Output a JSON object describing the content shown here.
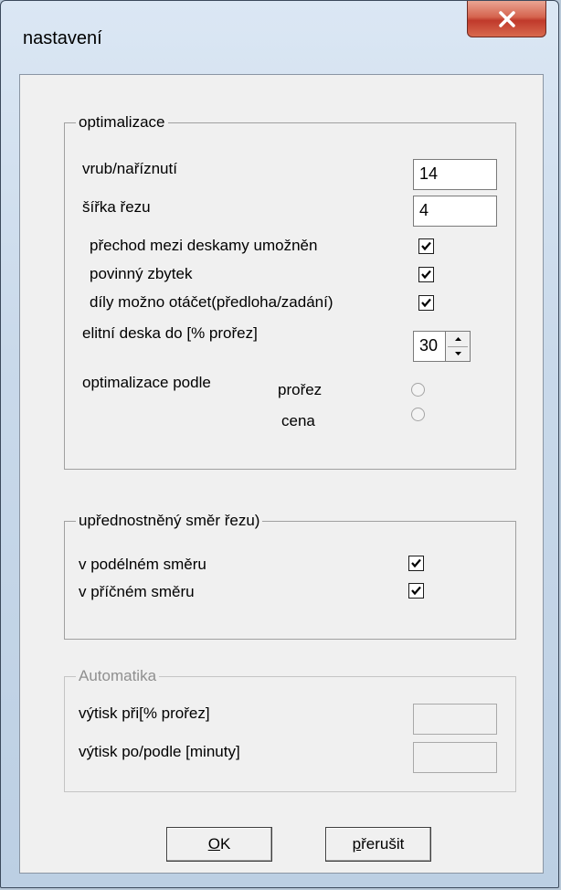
{
  "window": {
    "title": "nastavení"
  },
  "optimization": {
    "title": "optimalizace",
    "kerf_label": "vrub/naříznutí",
    "kerf_value": "14",
    "cut_width_label": "šířka řezu",
    "cut_width_value": "4",
    "transition_label": "přechod mezi deskamy umožněn",
    "transition_checked": true,
    "mandatory_rest_label": "povinný zbytek",
    "mandatory_rest_checked": true,
    "rotate_parts_label": "díly možno otáčet(předloha/zadání)",
    "rotate_parts_checked": true,
    "elite_board_label": "elitní deska do [% prořez]",
    "elite_board_value": "30",
    "optimize_by_label": "optimalizace podle",
    "option_waste_label": "prořez",
    "option_price_label": "cena"
  },
  "preferred_direction": {
    "title": "upřednostněný směr řezu)",
    "longitudinal_label": "v podélném směru",
    "longitudinal_checked": true,
    "transverse_label": "v příčném směru",
    "transverse_checked": true
  },
  "automation": {
    "title": "Automatika",
    "print_at_label": "výtisk při[% prořez]",
    "print_at_value": "",
    "print_after_label": "výtisk po/podle [minuty]",
    "print_after_value": ""
  },
  "buttons": {
    "ok_mnemonic": "O",
    "ok_rest": "K",
    "cancel_mnemonic": "p",
    "cancel_rest": "řerušit"
  }
}
